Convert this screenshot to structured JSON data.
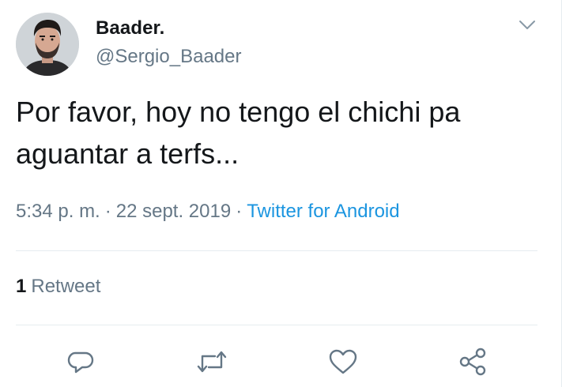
{
  "tweet": {
    "author": {
      "display_name": "Baader.",
      "handle": "@Sergio_Baader",
      "avatar_icon": "profile-photo"
    },
    "text_lines": [
      "Por favor, hoy no tengo el chichi pa",
      "aguantar a terfs..."
    ],
    "meta": {
      "time": "5:34 p. m.",
      "separator": "·",
      "date": "22 sept. 2019",
      "source": "Twitter for Android"
    },
    "stats": {
      "retweet_count": "1",
      "retweet_label": "Retweet"
    },
    "actions": [
      {
        "icon": "reply-icon"
      },
      {
        "icon": "retweet-icon"
      },
      {
        "icon": "like-icon"
      },
      {
        "icon": "share-icon"
      }
    ],
    "menu_icon": "chevron-down-icon"
  },
  "colors": {
    "text_primary": "#14171a",
    "text_secondary": "#657786",
    "link": "#1b95e0",
    "divider": "#e6ecf0"
  }
}
